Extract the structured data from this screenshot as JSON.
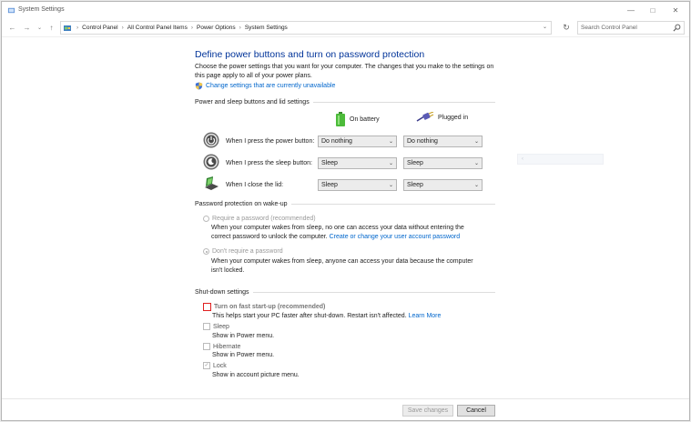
{
  "window": {
    "title": "System Settings"
  },
  "address_bar": {
    "breadcrumbs": [
      "Control Panel",
      "All Control Panel Items",
      "Power Options",
      "System Settings"
    ],
    "search_placeholder": "Search Control Panel"
  },
  "page": {
    "title": "Define power buttons and turn on password protection",
    "intro": "Choose the power settings that you want for your computer. The changes that you make to the settings on this page apply to all of your power plans.",
    "uac_link": "Change settings that are currently unavailable"
  },
  "power_section": {
    "heading": "Power and sleep buttons and lid settings",
    "col_battery": "On battery",
    "col_plugged": "Plugged in",
    "rows": [
      {
        "label": "When I press the power button:",
        "battery": "Do nothing",
        "plugged": "Do nothing",
        "icon": "power-button-icon"
      },
      {
        "label": "When I press the sleep button:",
        "battery": "Sleep",
        "plugged": "Sleep",
        "icon": "sleep-button-icon"
      },
      {
        "label": "When I close the lid:",
        "battery": "Sleep",
        "plugged": "Sleep",
        "icon": "laptop-lid-icon"
      }
    ]
  },
  "password_section": {
    "heading": "Password protection on wake-up",
    "require_label": "Require a password (recommended)",
    "require_desc": "When your computer wakes from sleep, no one can access your data without entering the correct password to unlock the computer.",
    "require_link": "Create or change your user account password",
    "norequire_label": "Don't require a password",
    "norequire_desc": "When your computer wakes from sleep, anyone can access your data because the computer isn't locked."
  },
  "shutdown_section": {
    "heading": "Shut-down settings",
    "items": [
      {
        "label": "Turn on fast start-up (recommended)",
        "desc": "This helps start your PC faster after shut-down. Restart isn't affected.",
        "link": "Learn More",
        "checked": false
      },
      {
        "label": "Sleep",
        "desc": "Show in Power menu.",
        "checked": false
      },
      {
        "label": "Hibernate",
        "desc": "Show in Power menu.",
        "checked": false
      },
      {
        "label": "Lock",
        "desc": "Show in account picture menu.",
        "checked": true
      }
    ]
  },
  "buttons": {
    "save": "Save changes",
    "cancel": "Cancel"
  },
  "colors": {
    "title": "#003399",
    "link": "#0066cc",
    "highlight": "#e02020"
  }
}
